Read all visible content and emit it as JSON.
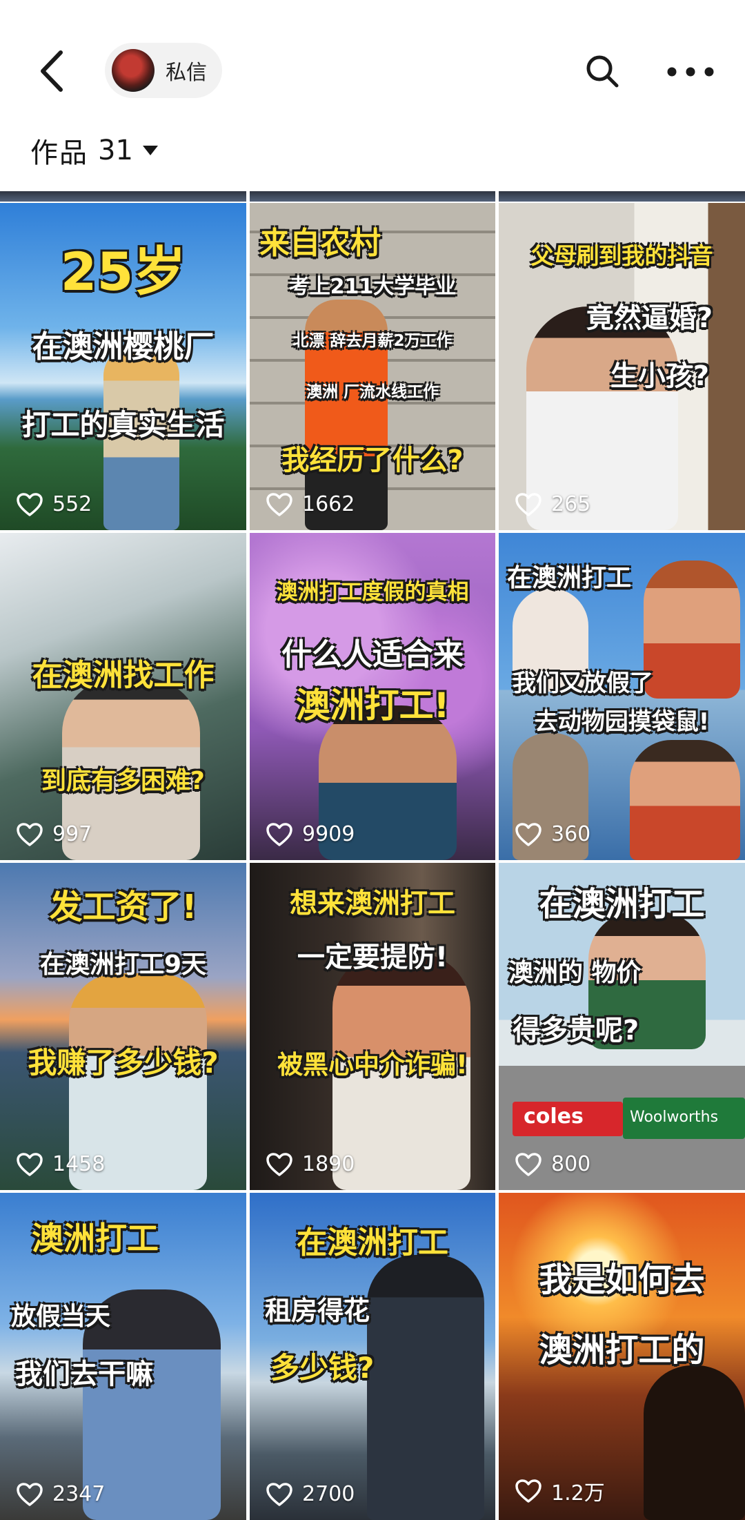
{
  "header": {
    "dm_label": "私信",
    "works_label": "作品",
    "works_count": "31"
  },
  "videos": [
    {
      "captions": [
        "25岁",
        "在澳洲樱桃厂",
        "打工的真实生活"
      ],
      "likes": "552"
    },
    {
      "captions": [
        "来自农村",
        "考上211大学毕业",
        "北漂    辞去月薪2万工作",
        "澳洲    厂流水线工作",
        "我经历了什么?"
      ],
      "likes": "1662"
    },
    {
      "captions": [
        "父母刷到我的抖音",
        "竟然逼婚?",
        "生小孩?"
      ],
      "likes": "265"
    },
    {
      "captions": [
        "在澳洲找工作",
        "到底有多困难?"
      ],
      "likes": "997"
    },
    {
      "captions": [
        "澳洲打工度假的真相",
        "什么人适合来",
        "澳洲打工!"
      ],
      "likes": "9909"
    },
    {
      "captions": [
        "在澳洲打工",
        "我们又放假了",
        "去动物园摸袋鼠!"
      ],
      "likes": "360"
    },
    {
      "captions": [
        "发工资了!",
        "在澳洲打工9天",
        "我赚了多少钱?"
      ],
      "likes": "1458"
    },
    {
      "captions": [
        "想来澳洲打工",
        "一定要提防!",
        "被黑心中介诈骗!"
      ],
      "likes": "1890"
    },
    {
      "captions": [
        "在澳洲打工",
        "澳洲的   物价",
        "得多贵呢?",
        "coles",
        "Woolworths"
      ],
      "likes": "800"
    },
    {
      "captions": [
        "澳洲打工",
        "放假当天",
        "我们去干嘛"
      ],
      "likes": "2347"
    },
    {
      "captions": [
        "在澳洲打工",
        "租房得花",
        "多少钱?"
      ],
      "likes": "2700"
    },
    {
      "captions": [
        "我是如何去",
        "澳洲打工的"
      ],
      "likes": "1.2万"
    }
  ]
}
